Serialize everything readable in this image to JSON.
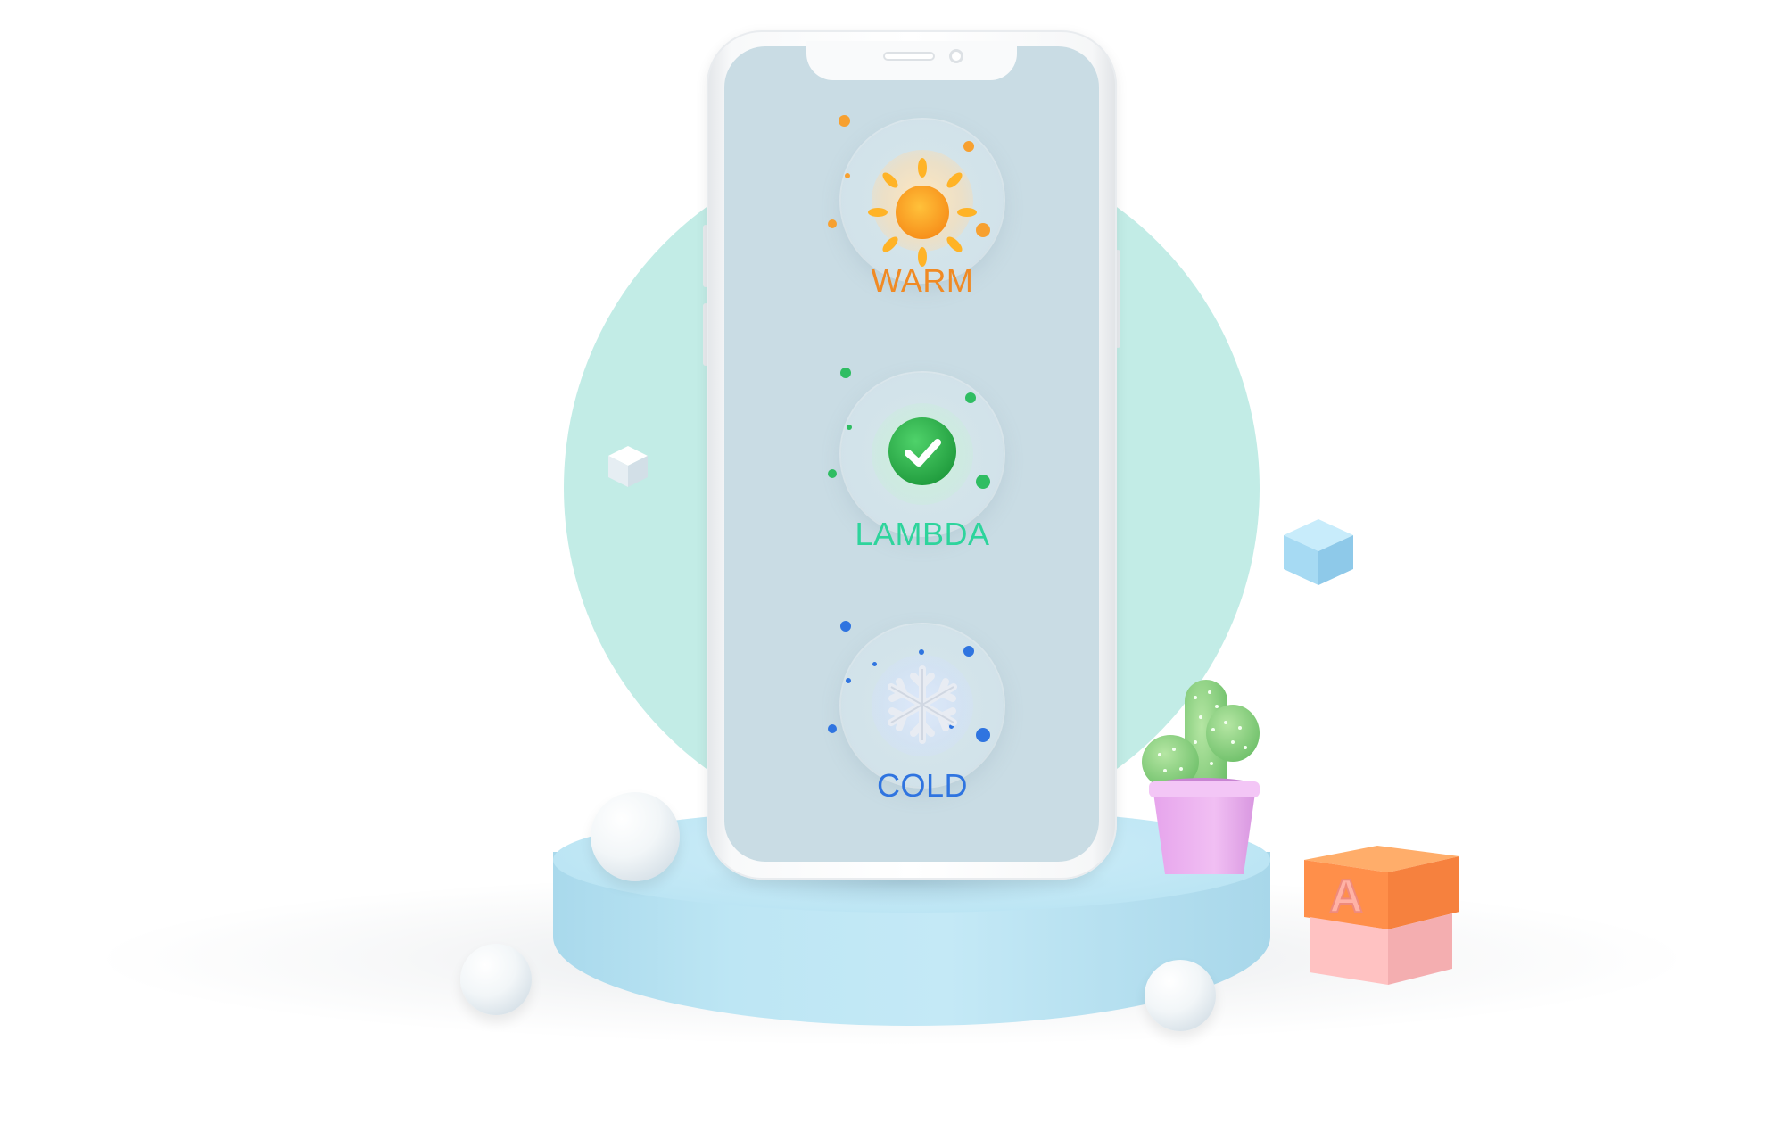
{
  "statuses": [
    {
      "label": "WARM",
      "icon": "sun-icon",
      "color": "#f08a24"
    },
    {
      "label": "LAMBDA",
      "icon": "check-icon",
      "color": "#2ed49c"
    },
    {
      "label": "COLD",
      "icon": "snowflake-icon",
      "color": "#2f74e0"
    }
  ],
  "block": {
    "letter": "A"
  }
}
